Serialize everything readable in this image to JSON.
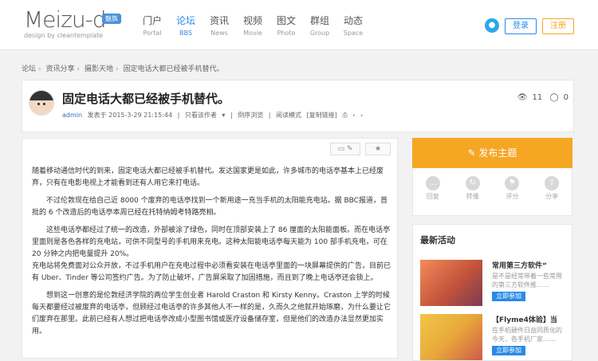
{
  "header": {
    "logo_text": "Meizu-d",
    "logo_badge": "魅族",
    "logo_sub": "design by cleantemplate",
    "nav": [
      {
        "cn": "门户",
        "en": "Portal"
      },
      {
        "cn": "论坛",
        "en": "BBS"
      },
      {
        "cn": "资讯",
        "en": "News"
      },
      {
        "cn": "视频",
        "en": "Movie"
      },
      {
        "cn": "图文",
        "en": "Photo"
      },
      {
        "cn": "群组",
        "en": "Group"
      },
      {
        "cn": "动态",
        "en": "Space"
      }
    ],
    "login": "登录",
    "register": "注册"
  },
  "breadcrumb": [
    "论坛",
    "资讯分享",
    "摄影天地",
    "固定电话大都已经被手机替代。"
  ],
  "thread": {
    "title": "固定电话大都已经被手机替代。",
    "author": "admin",
    "posted": "发表于 2015-3-29 21:15:44",
    "only_author": "只看该作者",
    "mode1": "倒序浏览",
    "mode2": "阅读模式",
    "copy_link": "[复制链接]",
    "views": "11",
    "replies": "0"
  },
  "post": {
    "paragraphs": [
      "随着移动通信时代的到来，固定电话大都已经被手机替代。发达国家更是如此，许多城市的电话亭基本上已经废弃，只有在电影电视上才能看到还有人用它来打电话。",
      "不过伦敦现在给自己近 8000 个废弃的电话亭找到一个新用途一充当手机的太阳能充电站。据 BBC报道，首批的 6 个改造后的电话亭本周已经在托特纳姆考特路亮相。",
      "这些电话亭都经过了统一的改造，外部被涂了绿色，同时在顶部安装上了 86 厘面的太阳能面板。而在电话亭里面则是各色各样的充电站，可供不同型号的手机用来充电。这种太阳能电话亭每天能为 100 部手机充电，可在 20 分钟之内把电量提升 20%。\n充电站将免费面对公众开放，不过手机用户在充电过程中必须看安装在电话亭里面的一块屏幕提供的广告，目前已有 Uber、Tinder 等公司签约广告。为了防止破坏，广告屏采取了加固措施，而且到了晚上电话亭还会锁上。",
      "想到这一创意的是伦敦经济学院的两位学生创业者 Harold Craston 和 Kirsty Kenny。Craston 上学的时候每天都要经过被废弃的电话亭，但顾经过电话亭的许多其他人不一样的是，久而久之他就开始琢磨，为什么要让它们废弃在那里。此前已经有人想过把电话亭改成小型图书馆或医疗设备储存室，但是他们的改造办法显然更加实用。"
    ]
  },
  "sidebar": {
    "publish": "发布主题",
    "actions": [
      "回复",
      "转播",
      "评分",
      "分享"
    ],
    "activity_title": "最新活动",
    "activities": [
      {
        "title": "常用第三方软件“",
        "desc": "是不是经常带着一些常用的第三方软件推……",
        "button": "立即参加"
      },
      {
        "title": "【Flyme4体验】当",
        "desc": "在手机硬件日益同质化的今天，各手机厂家……",
        "button": "立即参加"
      }
    ]
  }
}
